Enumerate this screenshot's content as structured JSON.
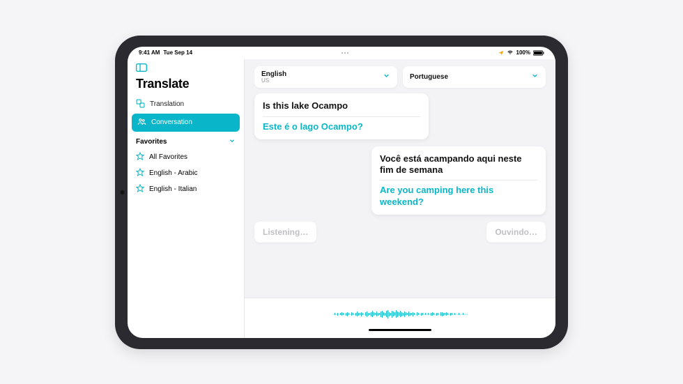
{
  "statusbar": {
    "time": "9:41 AM",
    "date": "Tue Sep 14",
    "battery": "100%"
  },
  "sidebar": {
    "title": "Translate",
    "nav": [
      {
        "icon": "translate-icon",
        "label": "Translation"
      },
      {
        "icon": "people-icon",
        "label": "Conversation"
      }
    ],
    "favorites": {
      "title": "Favorites",
      "items": [
        "All Favorites",
        "English - Arabic",
        "English - Italian"
      ]
    }
  },
  "main": {
    "lang_a": {
      "name": "English",
      "sub": "US"
    },
    "lang_b": {
      "name": "Portuguese",
      "sub": ""
    },
    "bubbles": [
      {
        "side": "left",
        "src": "Is this lake Ocampo",
        "tgt": "Este é o lago Ocampo?"
      },
      {
        "side": "right",
        "src": "Você está acampando aqui neste fim de semana",
        "tgt": "Are you camping here this weekend?"
      }
    ],
    "listening": {
      "left": "Listening…",
      "right": "Ouvindo…"
    }
  }
}
